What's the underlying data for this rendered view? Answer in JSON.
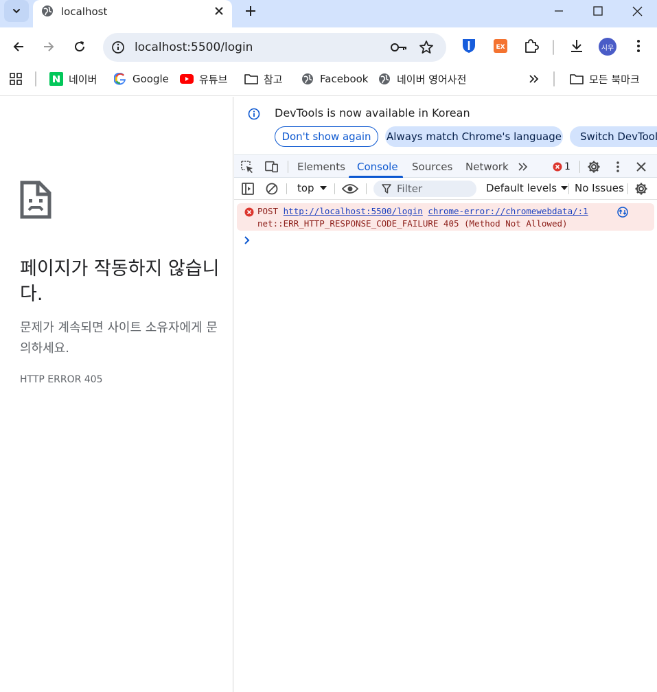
{
  "browser": {
    "tab": {
      "title": "localhost"
    },
    "address": {
      "url": "localhost:5500/login"
    },
    "profile": {
      "initials": "시우"
    },
    "colors": {
      "tab_strip": "#d3e3fd",
      "omnibox": "#e9eef6",
      "accent": "#0b57d0"
    }
  },
  "bookmarks": {
    "items": [
      {
        "label": "네이버",
        "icon": "naver-icon"
      },
      {
        "label": "Google",
        "icon": "google-icon"
      },
      {
        "label": "유튜브",
        "icon": "youtube-icon"
      },
      {
        "label": "참고",
        "icon": "folder-icon"
      },
      {
        "label": "Facebook",
        "icon": "globe-icon"
      },
      {
        "label": "네이버 영어사전",
        "icon": "globe-icon"
      }
    ],
    "all_bookmarks": "모든 북마크"
  },
  "error_page": {
    "heading": "페이지가 작동하지 않습니다.",
    "description": "문제가 계속되면 사이트 소유자에게 문의하세요.",
    "code": "HTTP ERROR 405"
  },
  "devtools": {
    "info_message": "DevTools is now available in Korean",
    "buttons": {
      "dont_show": "Don't show again",
      "match_language": "Always match Chrome's language",
      "switch": "Switch DevTools"
    },
    "tabs": [
      "Elements",
      "Console",
      "Sources",
      "Network"
    ],
    "active_tab": "Console",
    "error_count": "1",
    "console_toolbar": {
      "context": "top",
      "filter_placeholder": "Filter",
      "levels": "Default levels",
      "issues": "No Issues"
    },
    "console_error": {
      "method": "POST",
      "url": "http://localhost:5500/login",
      "source": "chrome-error://chromewebdata/:1",
      "message": "net::ERR_HTTP_RESPONSE_CODE_FAILURE 405 (Method Not Allowed)"
    }
  }
}
